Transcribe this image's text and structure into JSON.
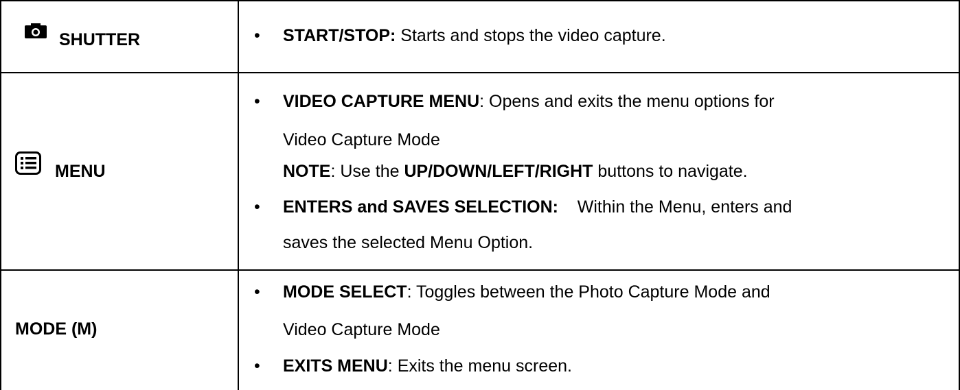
{
  "rows": [
    {
      "label": "SHUTTER",
      "icon": "camera-icon",
      "items": [
        {
          "bullet": true,
          "bold": "START/STOP:",
          "text": " Starts and stops the video capture."
        }
      ]
    },
    {
      "label": "MENU",
      "icon": "menu-list-icon",
      "items": [
        {
          "bullet": true,
          "bold": "VIDEO CAPTURE MENU",
          "text": ": Opens and exits the menu options for"
        },
        {
          "bullet": false,
          "bold": "",
          "text": "Video Capture Mode"
        },
        {
          "bullet": false,
          "bold": "NOTE",
          "text": ": Use the ",
          "bold2": "UP/DOWN/LEFT/RIGHT",
          "text2": " buttons to navigate."
        },
        {
          "bullet": true,
          "bold": "ENTERS and SAVES SELECTION:",
          "text": "    Within the Menu, enters and"
        },
        {
          "bullet": false,
          "bold": "",
          "text": "saves the selected Menu Option."
        }
      ]
    },
    {
      "label": "MODE (M)",
      "icon": "",
      "items": [
        {
          "bullet": true,
          "bold": "MODE SELECT",
          "text": ": Toggles between the Photo Capture Mode and"
        },
        {
          "bullet": false,
          "bold": "",
          "text": "Video Capture Mode"
        },
        {
          "bullet": true,
          "bold": "EXITS MENU",
          "text": ": Exits the menu screen."
        }
      ]
    }
  ]
}
